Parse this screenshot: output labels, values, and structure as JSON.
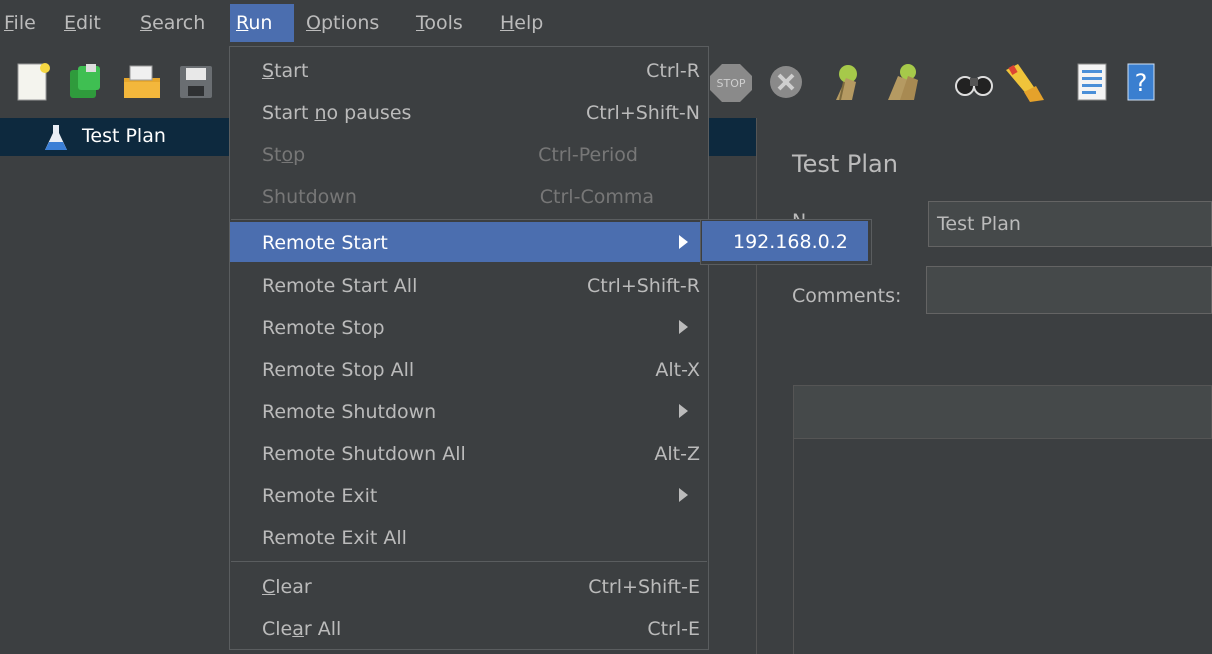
{
  "menubar": {
    "items": [
      {
        "mn": "F",
        "rest": "ile"
      },
      {
        "mn": "E",
        "rest": "dit"
      },
      {
        "mn": "S",
        "rest": "earch"
      },
      {
        "mn": "R",
        "rest": "un"
      },
      {
        "mn": "O",
        "rest": "ptions"
      },
      {
        "mn": "T",
        "rest": "ools"
      },
      {
        "mn": "H",
        "rest": "elp"
      }
    ],
    "active_index": 3
  },
  "toolbar": {
    "icons": [
      "new-icon",
      "templates-icon",
      "open-icon",
      "save-icon",
      "stop-icon",
      "shutdown-icon",
      "clear-icon",
      "clear-all-icon",
      "search-icon",
      "reset-search-icon",
      "function-helper-icon",
      "help-icon"
    ]
  },
  "tree": {
    "root_label": "Test Plan"
  },
  "right_panel": {
    "title": "Test Plan",
    "name_label": "N",
    "name_value": "Test Plan",
    "comments_label": "Comments:"
  },
  "run_menu": {
    "items": [
      {
        "pre": "",
        "mn": "S",
        "post": "tart",
        "shortcut": "Ctrl-R"
      },
      {
        "pre": "Start ",
        "mn": "n",
        "post": "o pauses",
        "shortcut": "Ctrl+Shift-N"
      },
      {
        "pre": "St",
        "mn": "o",
        "post": "p",
        "shortcut": "Ctrl-Period",
        "disabled": true
      },
      {
        "pre": "Shutdown",
        "mn": "",
        "post": "",
        "shortcut": "Ctrl-Comma",
        "disabled": true
      },
      {
        "pre": "Remote Start",
        "mn": "",
        "post": "",
        "submenu": true,
        "selected": true
      },
      {
        "pre": "Remote Start All",
        "mn": "",
        "post": "",
        "shortcut": "Ctrl+Shift-R"
      },
      {
        "pre": "Remote Stop",
        "mn": "",
        "post": "",
        "submenu": true
      },
      {
        "pre": "Remote Stop All",
        "mn": "",
        "post": "",
        "shortcut": "Alt-X"
      },
      {
        "pre": "Remote Shutdown",
        "mn": "",
        "post": "",
        "submenu": true
      },
      {
        "pre": "Remote Shutdown All",
        "mn": "",
        "post": "",
        "shortcut": "Alt-Z"
      },
      {
        "pre": "Remote Exit",
        "mn": "",
        "post": "",
        "submenu": true
      },
      {
        "pre": "Remote Exit All",
        "mn": "",
        "post": ""
      },
      {
        "pre": "",
        "mn": "C",
        "post": "lear",
        "shortcut": "Ctrl+Shift-E"
      },
      {
        "pre": "Cle",
        "mn": "a",
        "post": "r All",
        "shortcut": "Ctrl-E"
      }
    ]
  },
  "remote_start_submenu": {
    "items": [
      "192.168.0.2"
    ]
  },
  "colors": {
    "background": "#3c3f41",
    "selection": "#4b6eaf",
    "tree_selection": "#0d293e"
  }
}
